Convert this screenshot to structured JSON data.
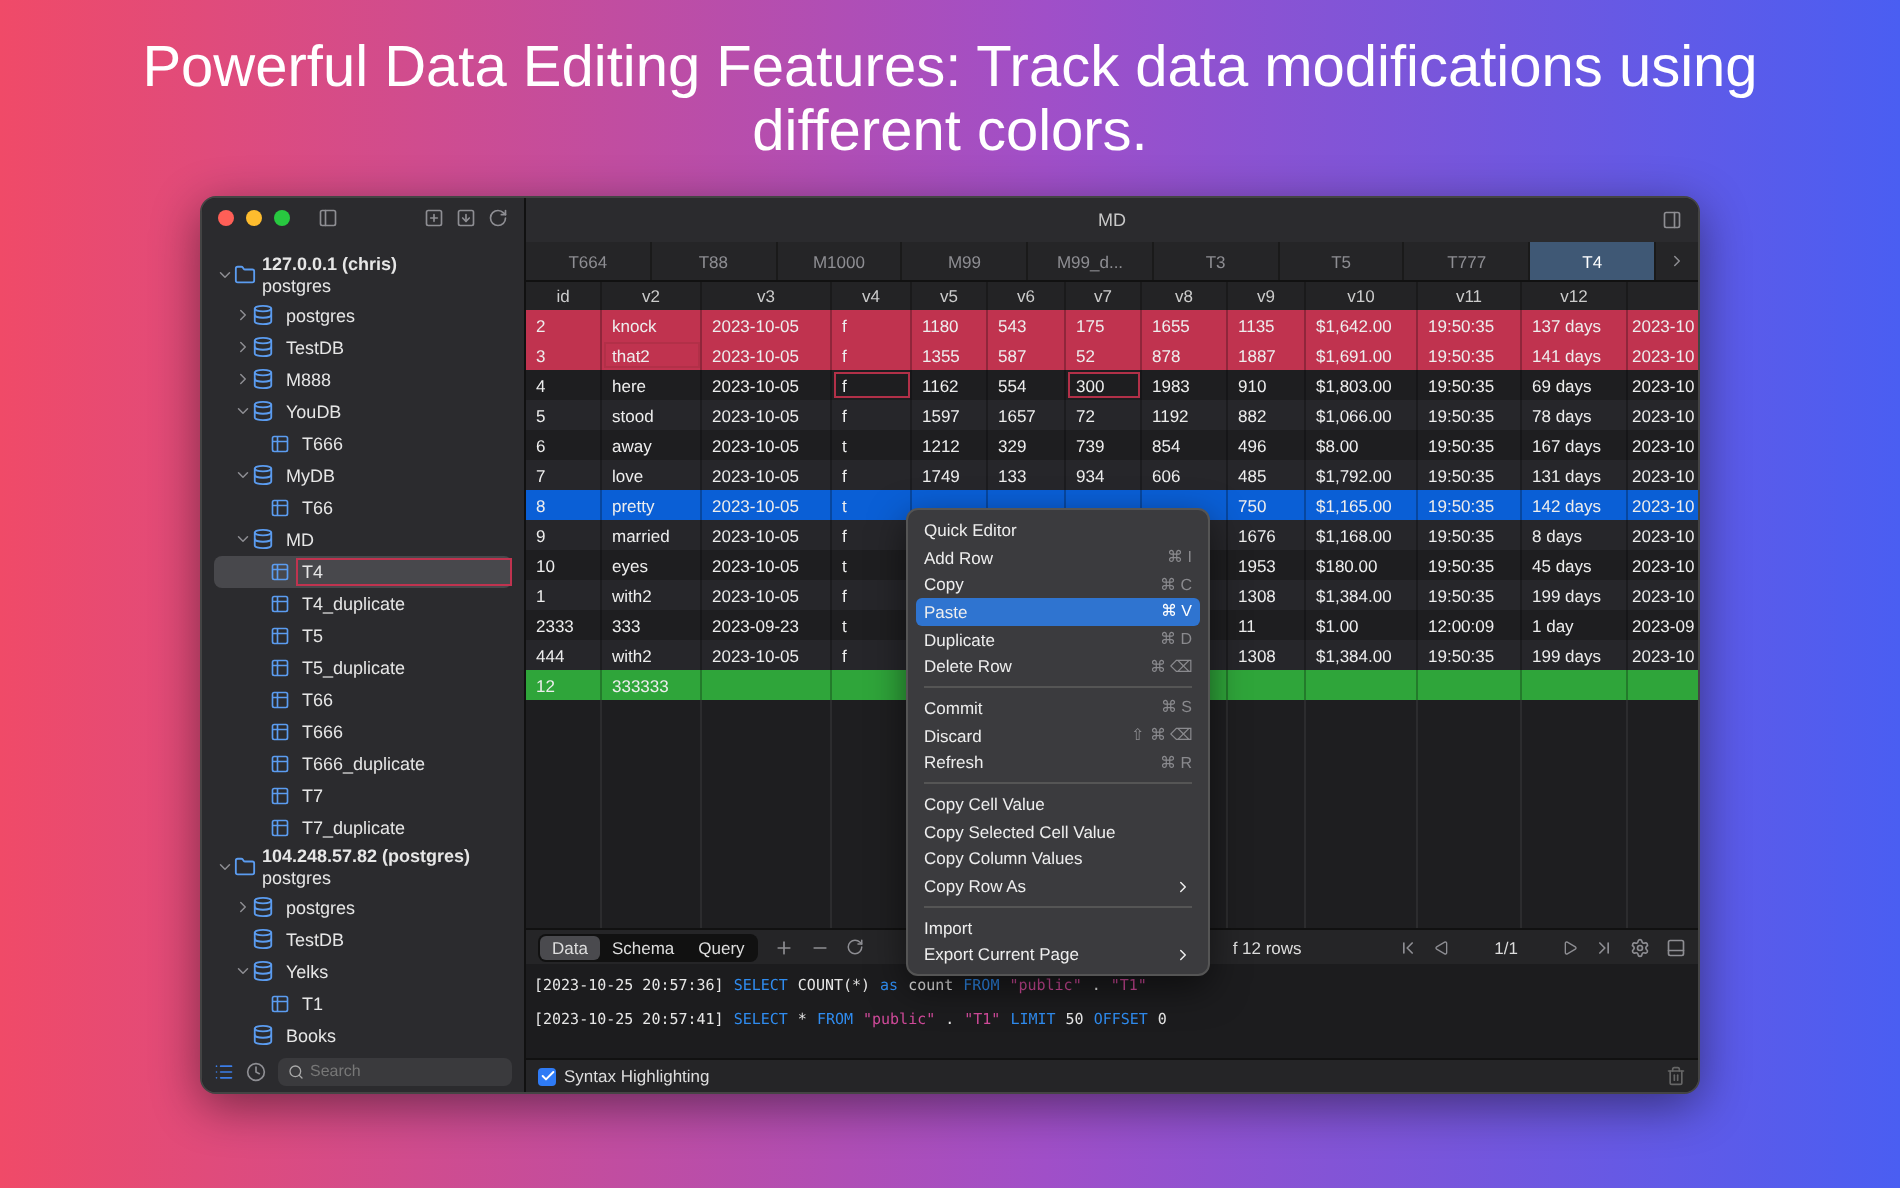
{
  "headline": "Powerful Data Editing Features: Track data modifications using different colors.",
  "window": {
    "title": "MD"
  },
  "sidebar": {
    "tree": [
      {
        "kind": "server",
        "name": "127.0.0.1 (chris)",
        "subtitle": "postgres",
        "expanded": true,
        "selected": false,
        "children": [
          {
            "kind": "database",
            "name": "postgres",
            "expanded": false,
            "selected": false
          },
          {
            "kind": "database",
            "name": "TestDB",
            "expanded": false,
            "selected": false
          },
          {
            "kind": "database",
            "name": "M888",
            "expanded": false,
            "selected": false
          },
          {
            "kind": "database",
            "name": "YouDB",
            "expanded": true,
            "selected": false,
            "children": [
              {
                "kind": "table",
                "name": "T666",
                "selected": false
              }
            ]
          },
          {
            "kind": "database",
            "name": "MyDB",
            "expanded": true,
            "selected": false,
            "children": [
              {
                "kind": "table",
                "name": "T66",
                "selected": false
              }
            ]
          },
          {
            "kind": "database",
            "name": "MD",
            "expanded": true,
            "selected": false,
            "children": [
              {
                "kind": "table",
                "name": "T4",
                "selected": true
              },
              {
                "kind": "table",
                "name": "T4_duplicate",
                "selected": false
              },
              {
                "kind": "table",
                "name": "T5",
                "selected": false
              },
              {
                "kind": "table",
                "name": "T5_duplicate",
                "selected": false
              },
              {
                "kind": "table",
                "name": "T66",
                "selected": false
              },
              {
                "kind": "table",
                "name": "T666",
                "selected": false
              },
              {
                "kind": "table",
                "name": "T666_duplicate",
                "selected": false
              },
              {
                "kind": "table",
                "name": "T7",
                "selected": false
              },
              {
                "kind": "table",
                "name": "T7_duplicate",
                "selected": false
              }
            ]
          }
        ]
      },
      {
        "kind": "server",
        "name": "104.248.57.82 (postgres)",
        "subtitle": "postgres",
        "expanded": true,
        "selected": false,
        "children": [
          {
            "kind": "database",
            "name": "postgres",
            "expanded": false,
            "selected": false
          },
          {
            "kind": "database",
            "name": "TestDB",
            "selected": false
          },
          {
            "kind": "database",
            "name": "Yelks",
            "expanded": true,
            "selected": false,
            "children": [
              {
                "kind": "table",
                "name": "T1",
                "selected": false
              }
            ]
          },
          {
            "kind": "database",
            "name": "Books",
            "selected": false
          }
        ]
      }
    ],
    "search": {
      "placeholder": "Search"
    }
  },
  "tabs": [
    {
      "label": "T664",
      "selected": false
    },
    {
      "label": "T88",
      "selected": false
    },
    {
      "label": "M1000",
      "selected": false
    },
    {
      "label": "M99",
      "selected": false
    },
    {
      "label": "M99_d...",
      "selected": false
    },
    {
      "label": "T3",
      "selected": false
    },
    {
      "label": "T5",
      "selected": false
    },
    {
      "label": "T777",
      "selected": false
    },
    {
      "label": "T4",
      "selected": true
    }
  ],
  "table": {
    "columns": [
      "id",
      "v2",
      "v3",
      "v4",
      "v5",
      "v6",
      "v7",
      "v8",
      "v9",
      "v10",
      "v11",
      "v12"
    ],
    "rows": [
      {
        "deleted": true,
        "inserted": false,
        "selected": false,
        "cells": [
          "2",
          "knock",
          "2023-10-05",
          "f",
          "1180",
          "543",
          "175",
          "1655",
          "1135",
          "$1,642.00",
          "19:50:35",
          "137 days",
          "2023-10"
        ]
      },
      {
        "deleted": true,
        "inserted": false,
        "selected": false,
        "cells": [
          "3",
          {
            "text": "that2",
            "edited": true
          },
          "2023-10-05",
          "f",
          "1355",
          "587",
          "52",
          "878",
          "1887",
          "$1,691.00",
          "19:50:35",
          "141 days",
          "2023-10"
        ]
      },
      {
        "deleted": false,
        "inserted": false,
        "selected": false,
        "cells": [
          "4",
          "here",
          "2023-10-05",
          {
            "text": "f",
            "edited": true
          },
          "1162",
          "554",
          {
            "text": "300",
            "edited": true
          },
          "1983",
          "910",
          "$1,803.00",
          "19:50:35",
          "69 days",
          "2023-10"
        ]
      },
      {
        "deleted": false,
        "inserted": false,
        "selected": false,
        "cells": [
          "5",
          "stood",
          "2023-10-05",
          "f",
          "1597",
          "1657",
          "72",
          "1192",
          "882",
          "$1,066.00",
          "19:50:35",
          "78 days",
          "2023-10"
        ]
      },
      {
        "deleted": false,
        "inserted": false,
        "selected": false,
        "cells": [
          "6",
          "away",
          "2023-10-05",
          "t",
          "1212",
          "329",
          "739",
          "854",
          "496",
          "$8.00",
          "19:50:35",
          "167 days",
          "2023-10"
        ]
      },
      {
        "deleted": false,
        "inserted": false,
        "selected": false,
        "cells": [
          "7",
          "love",
          "2023-10-05",
          "f",
          "1749",
          "133",
          "934",
          "606",
          "485",
          "$1,792.00",
          "19:50:35",
          "131 days",
          "2023-10"
        ]
      },
      {
        "deleted": false,
        "inserted": false,
        "selected": true,
        "cells": [
          "8",
          "pretty",
          "2023-10-05",
          "t",
          null,
          null,
          null,
          null,
          "750",
          "$1,165.00",
          "19:50:35",
          "142 days",
          "2023-10"
        ]
      },
      {
        "deleted": false,
        "inserted": false,
        "selected": false,
        "cells": [
          "9",
          "married",
          "2023-10-05",
          "f",
          null,
          null,
          null,
          null,
          "1676",
          "$1,168.00",
          "19:50:35",
          "8 days",
          "2023-10"
        ]
      },
      {
        "deleted": false,
        "inserted": false,
        "selected": false,
        "cells": [
          "10",
          "eyes",
          "2023-10-05",
          "t",
          null,
          null,
          null,
          null,
          "1953",
          "$180.00",
          "19:50:35",
          "45 days",
          "2023-10"
        ]
      },
      {
        "deleted": false,
        "inserted": false,
        "selected": false,
        "cells": [
          "1",
          "with2",
          "2023-10-05",
          "f",
          null,
          null,
          null,
          null,
          "1308",
          "$1,384.00",
          "19:50:35",
          "199 days",
          "2023-10"
        ]
      },
      {
        "deleted": false,
        "inserted": false,
        "selected": false,
        "cells": [
          "2333",
          "333",
          "2023-09-23",
          "t",
          null,
          null,
          null,
          null,
          "11",
          "$1.00",
          "12:00:09",
          "1 day",
          "2023-09"
        ]
      },
      {
        "deleted": false,
        "inserted": false,
        "selected": false,
        "cells": [
          "444",
          "with2",
          "2023-10-05",
          "f",
          null,
          null,
          null,
          null,
          "1308",
          "$1,384.00",
          "19:50:35",
          "199 days",
          "2023-10"
        ]
      },
      {
        "deleted": false,
        "inserted": true,
        "selected": false,
        "cells": [
          "12",
          "333333",
          null,
          null,
          null,
          null,
          null,
          null,
          null,
          null,
          null,
          null,
          null
        ]
      }
    ]
  },
  "view_tabs": [
    {
      "label": "Data",
      "selected": true
    },
    {
      "label": "Schema",
      "selected": false
    },
    {
      "label": "Query",
      "selected": false
    }
  ],
  "row_count": "f 12 rows",
  "page": "1/1",
  "log": [
    {
      "time": "[2023-10-25 20:57:36]",
      "tokens": [
        {
          "kind": "keyword",
          "text": "SELECT"
        },
        {
          "kind": "plain",
          "text": "COUNT(*)"
        },
        {
          "kind": "keyword",
          "text": "as"
        },
        {
          "kind": "plain",
          "text": "count"
        },
        {
          "kind": "keyword",
          "text": "FROM"
        },
        {
          "kind": "string",
          "text": "\"public\""
        },
        {
          "kind": "plain",
          "text": "."
        },
        {
          "kind": "string",
          "text": "\"T1\""
        }
      ]
    },
    {
      "time": "[2023-10-25 20:57:41]",
      "tokens": [
        {
          "kind": "keyword",
          "text": "SELECT"
        },
        {
          "kind": "plain",
          "text": "*"
        },
        {
          "kind": "keyword",
          "text": "FROM"
        },
        {
          "kind": "string",
          "text": "\"public\""
        },
        {
          "kind": "plain",
          "text": "."
        },
        {
          "kind": "string",
          "text": "\"T1\""
        },
        {
          "kind": "keyword",
          "text": "LIMIT"
        },
        {
          "kind": "plain",
          "text": "50"
        },
        {
          "kind": "keyword",
          "text": "OFFSET"
        },
        {
          "kind": "plain",
          "text": "0"
        }
      ]
    }
  ],
  "syntax_highlighting": {
    "label": "Syntax Highlighting",
    "checked": true
  },
  "context_menu": {
    "groups": [
      [
        {
          "label": "Quick Editor",
          "selected": false,
          "submenu": false
        },
        {
          "label": "Add Row",
          "shortcut": "⌘ I",
          "selected": false,
          "submenu": false
        },
        {
          "label": "Copy",
          "shortcut": "⌘ C",
          "selected": false,
          "submenu": false
        },
        {
          "label": "Paste",
          "shortcut": "⌘ V",
          "selected": true,
          "submenu": false
        },
        {
          "label": "Duplicate",
          "shortcut": "⌘ D",
          "selected": false,
          "submenu": false
        },
        {
          "label": "Delete Row",
          "shortcut": "⌘ ⌫",
          "selected": false,
          "submenu": false
        }
      ],
      [
        {
          "label": "Commit",
          "shortcut": "⌘ S",
          "selected": false,
          "submenu": false
        },
        {
          "label": "Discard",
          "shortcut": "⇧ ⌘ ⌫",
          "selected": false,
          "submenu": false
        },
        {
          "label": "Refresh",
          "shortcut": "⌘ R",
          "selected": false,
          "submenu": false
        }
      ],
      [
        {
          "label": "Copy Cell Value",
          "selected": false,
          "submenu": false
        },
        {
          "label": "Copy Selected Cell Value",
          "selected": false,
          "submenu": false
        },
        {
          "label": "Copy Column Values",
          "selected": false,
          "submenu": false
        },
        {
          "label": "Copy Row As",
          "selected": false,
          "submenu": true
        }
      ],
      [
        {
          "label": "Import",
          "selected": false,
          "submenu": false
        },
        {
          "label": "Export Current Page",
          "selected": false,
          "submenu": true
        }
      ]
    ]
  }
}
